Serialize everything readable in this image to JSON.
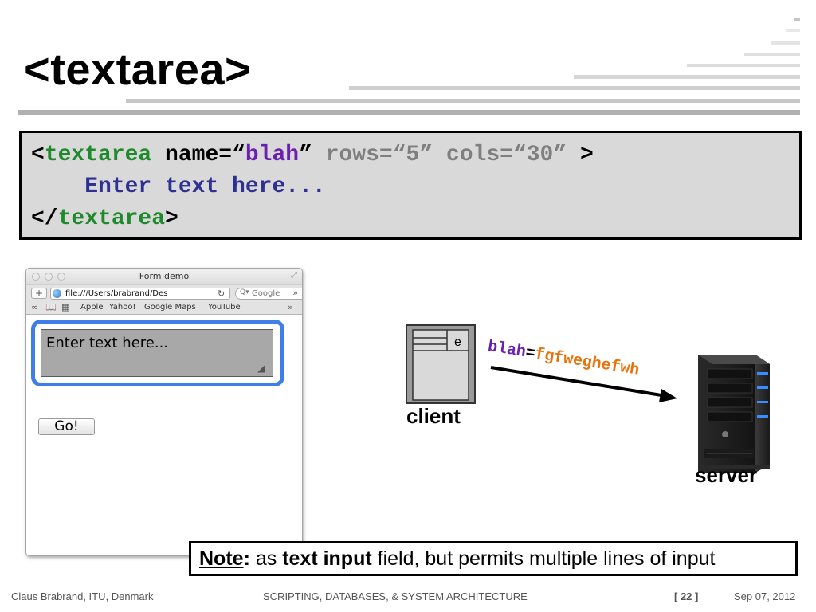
{
  "slide": {
    "title": "<textarea>"
  },
  "code": {
    "line1_open": "<",
    "line1_tag": "textarea",
    "line1_attr": " name=“",
    "line1_name_value": "blah",
    "line1_close_quote": "”",
    "line1_rest": " rows=“5” cols=“30” ",
    "line1_end": ">",
    "line2_indent": "    ",
    "line2_text": "Enter text here...",
    "line3_open": "</",
    "line3_tag": "textarea",
    "line3_end": ">"
  },
  "browser": {
    "window_title": "Form demo",
    "add_button": "+",
    "url": "file:///Users/brabrand/Des",
    "reload_glyph": "↻",
    "search_placeholder": "Google",
    "search_glyph": "Q▾",
    "overflow_glyph": "»",
    "bookmarks": [
      "Apple",
      "Yahoo!",
      "Google Maps",
      "YouTube"
    ],
    "textarea_value": "Enter text here...",
    "go_button": "Go!"
  },
  "diagram": {
    "client_label": "client",
    "client_field_letter": "e",
    "server_label": "server",
    "param_name": "blah",
    "param_eq": "=",
    "param_value": "fgfweghefwh"
  },
  "note": {
    "label": "Note",
    "colon": ":",
    "text_a": " as ",
    "text_bold": "text input",
    "text_b": " field, but permits multiple lines of input"
  },
  "footer": {
    "author": "Claus Brabrand, ITU, Denmark",
    "course": "SCRIPTING, DATABASES, & SYSTEM ARCHITECTURE",
    "page": "[ 22 ]",
    "date": "Sep  07, 2012"
  },
  "colors": {
    "code_green": "#1f8a2c",
    "code_purple": "#6a1fb0",
    "code_blue": "#2e3192",
    "focus_blue": "#3d7ee8",
    "param_orange": "#e8720c"
  }
}
